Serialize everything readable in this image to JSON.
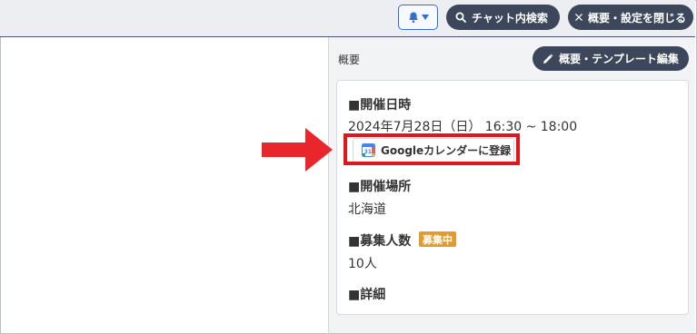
{
  "topbar": {
    "bell_button_icon": "bell-icon",
    "search_button_label": "チャット内検索",
    "close_button_label": "概要・設定を閉じる"
  },
  "panel": {
    "section_label": "概要",
    "edit_button_label": "概要・テンプレート編集"
  },
  "event": {
    "datetime_heading": "■開催日時",
    "datetime_value": "2024年7月28日（日） 16:30 ~ 18:00",
    "gcal_button_label": "Googleカレンダーに登録",
    "location_heading": "■開催場所",
    "location_value": "北海道",
    "capacity_heading": "■募集人数",
    "capacity_badge": "募集中",
    "capacity_value": "10人",
    "details_heading": "■詳細"
  },
  "colors": {
    "accent_dark": "#3c475c",
    "highlight_red": "#e0161c",
    "badge_orange": "#e49b2a",
    "bell_blue": "#2f6fd6"
  }
}
